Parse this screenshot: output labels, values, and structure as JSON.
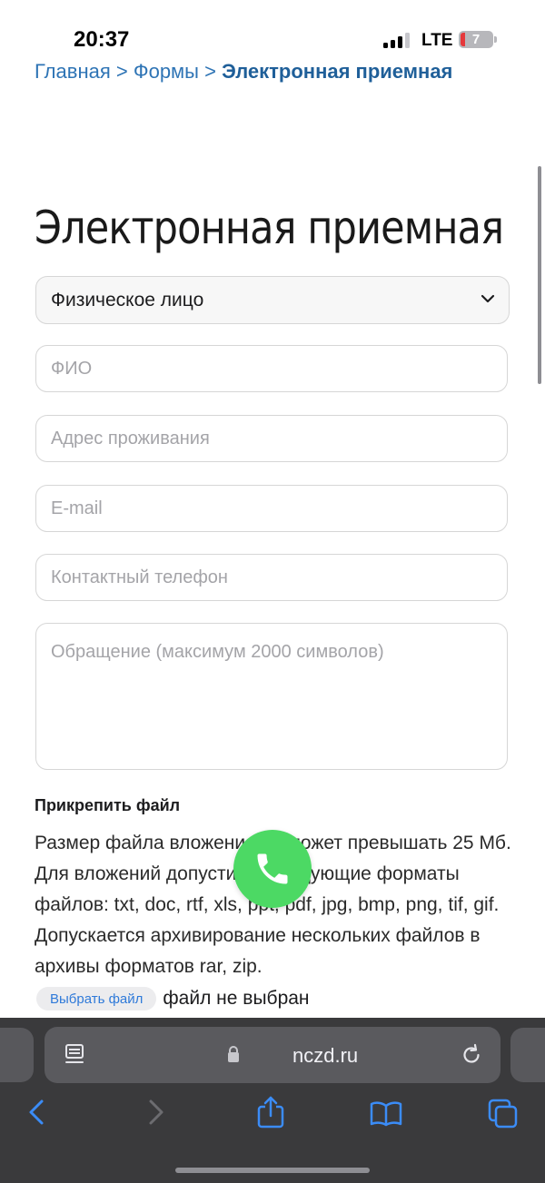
{
  "status_bar": {
    "time": "20:37",
    "network": "LTE",
    "battery": "7"
  },
  "breadcrumb": {
    "home": "Главная",
    "section": "Формы",
    "separator": ">",
    "current": "Электронная приемная"
  },
  "page": {
    "title": "Электронная приемная"
  },
  "form": {
    "person_type": {
      "selected": "Физическое лицо"
    },
    "full_name": {
      "placeholder": "ФИО"
    },
    "address": {
      "placeholder": "Адрес проживания"
    },
    "email": {
      "placeholder": "E-mail"
    },
    "phone": {
      "placeholder": "Контактный телефон"
    },
    "message": {
      "placeholder": "Обращение (максимум 2000 символов)"
    }
  },
  "attachment": {
    "title": "Прикрепить файл",
    "info": "Размер файла вложения не может превышать 25 Мб. Для вложений допустимы следующие форматы файлов: txt, doc, rtf, xls, ppt, pdf, jpg, bmp, png, tif, gif. Допускается архивирование нескольких файлов в архивы форматов rar, zip.",
    "choose_button": "Выбрать файл",
    "status": "файл не выбран"
  },
  "browser": {
    "url": "nczd.ru",
    "icons": [
      "page-menu-icon",
      "lock-icon",
      "reload-icon",
      "back-icon",
      "forward-icon",
      "share-icon",
      "bookmarks-icon",
      "tabs-icon"
    ]
  },
  "colors": {
    "accent": "#2f7ad9",
    "call_button": "#4cd964",
    "toolbar": "#3a3a3c"
  }
}
